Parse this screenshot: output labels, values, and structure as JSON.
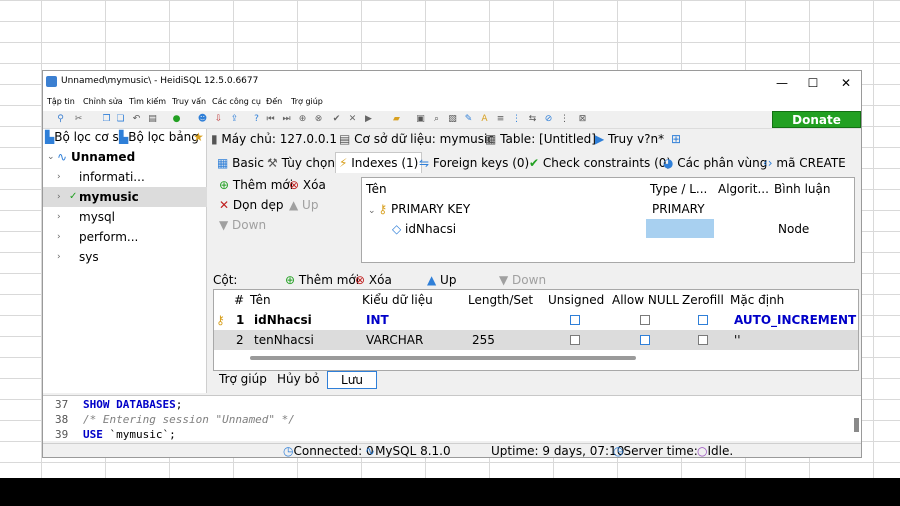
{
  "window": {
    "title": "Unnamed\\mymusic\\ - HeidiSQL 12.5.0.6677",
    "controls": {
      "minimize": "—",
      "maximize": "☐",
      "close": "✕"
    }
  },
  "menu": [
    "Tập tin",
    "Chỉnh sửa",
    "Tìm kiếm",
    "Truy vấn",
    "Các công cụ",
    "Đến",
    "Trợ giúp"
  ],
  "toolbar": {
    "donate_label": "Donate"
  },
  "left_pane": {
    "tabs": [
      "Bộ lọc cơ s",
      "Bộ lọc bảng"
    ],
    "tree": {
      "root": "Unnamed",
      "databases": [
        "informati...",
        "mymusic",
        "mysql",
        "perform...",
        "sys"
      ],
      "selected": "mymusic"
    }
  },
  "breadcrumbs": {
    "host": "Máy chủ: 127.0.0.1",
    "database": "Cơ sở dữ liệu: mymusic",
    "table": "Table: [Untitled]",
    "query": "Truy v?n*"
  },
  "tabs": [
    {
      "label": "Basic"
    },
    {
      "label": "Tùy chọn"
    },
    {
      "label": "Indexes (1)",
      "active": true
    },
    {
      "label": "Foreign keys (0)"
    },
    {
      "label": "Check constraints (0)"
    },
    {
      "label": "Các phân vùng"
    },
    {
      "label": "mã CREATE"
    }
  ],
  "index_actions": {
    "add": "Thêm mới",
    "delete": "Xóa",
    "clear": "Dọn dẹp",
    "up": "Up",
    "down": "Down"
  },
  "index_grid": {
    "headers": [
      "Tên",
      "Type / L...",
      "Algorit...",
      "Bình luận"
    ],
    "key_name": "PRIMARY KEY",
    "key_type": "PRIMARY",
    "column_name": "idNhacsi",
    "algorithm": "Node"
  },
  "columns_bar": {
    "label": "Cột:",
    "add": "Thêm mới",
    "delete": "Xóa",
    "up": "Up",
    "down": "Down"
  },
  "columns": {
    "headers": [
      "#",
      "Tên",
      "Kiểu dữ liệu",
      "Length/Set",
      "Unsigned",
      "Allow NULL",
      "Zerofill",
      "Mặc định"
    ],
    "rows": [
      {
        "num": "1",
        "name": "idNhacsi",
        "type": "INT",
        "length": "",
        "default": "AUTO_INCREMENT"
      },
      {
        "num": "2",
        "name": "tenNhacsi",
        "type": "VARCHAR",
        "length": "255",
        "default": "''"
      }
    ]
  },
  "buttons": {
    "help": "Trợ giúp",
    "cancel": "Hủy bỏ",
    "save": "Lưu"
  },
  "sql_log": [
    {
      "n": "37",
      "parts": [
        {
          "t": "SHOW DATABASES",
          "c": "kw"
        },
        {
          "t": ";",
          "c": ""
        }
      ]
    },
    {
      "n": "38",
      "parts": [
        {
          "t": "/* Entering session \"Unnamed\" */",
          "c": "cm"
        }
      ]
    },
    {
      "n": "39",
      "parts": [
        {
          "t": "USE",
          "c": "kw"
        },
        {
          "t": " `mymusic`;",
          "c": ""
        }
      ]
    }
  ],
  "status": {
    "connected": "Connected: 0",
    "server": "MySQL 8.1.0",
    "uptime": "Uptime: 9 days, 07:10",
    "server_time": "Server time:",
    "idle": "Idle."
  }
}
